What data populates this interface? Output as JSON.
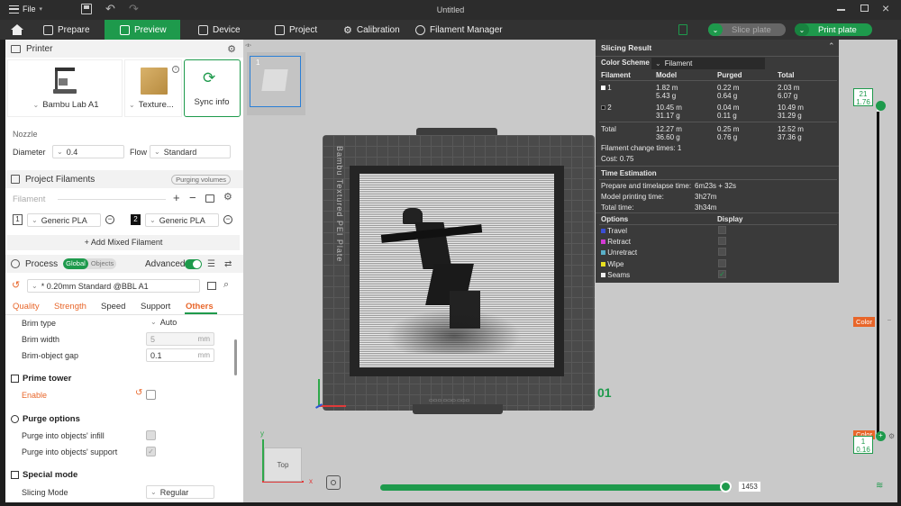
{
  "titlebar": {
    "file_label": "File",
    "title": "Untitled"
  },
  "nav": {
    "tabs": [
      {
        "label": "Prepare"
      },
      {
        "label": "Preview"
      },
      {
        "label": "Device"
      },
      {
        "label": "Project"
      },
      {
        "label": "Calibration"
      },
      {
        "label": "Filament Manager"
      }
    ],
    "slice_plate": "Slice plate",
    "print_plate": "Print plate"
  },
  "printer": {
    "section_title": "Printer",
    "printer_name": "Bambu Lab A1",
    "plate_name": "Texture...",
    "sync_info": "Sync info",
    "nozzle_label": "Nozzle",
    "diameter_label": "Diameter",
    "diameter_value": "0.4",
    "flow_label": "Flow",
    "flow_value": "Standard"
  },
  "filaments": {
    "section_title": "Project Filaments",
    "purging_volumes": "Purging volumes",
    "filament_label": "Filament",
    "items": [
      {
        "index": "1",
        "name": "Generic PLA",
        "color": "#ffffff"
      },
      {
        "index": "2",
        "name": "Generic PLA",
        "color": "#111111"
      }
    ],
    "add_mixed": "+ Add Mixed Filament"
  },
  "process": {
    "section_title": "Process",
    "toggle_global": "Global",
    "toggle_objects": "Objects",
    "advanced_label": "Advanced",
    "preset": "* 0.20mm Standard @BBL A1",
    "tabs": [
      "Quality",
      "Strength",
      "Speed",
      "Support",
      "Others"
    ],
    "active_tab": "Others",
    "brim_type_label": "Brim type",
    "brim_type_value": "Auto",
    "brim_width_label": "Brim width",
    "brim_width_value": "5",
    "brim_gap_label": "Brim-object gap",
    "brim_gap_value": "0.1",
    "unit_mm": "mm",
    "prime_tower_title": "Prime tower",
    "enable_label": "Enable",
    "purge_title": "Purge options",
    "purge_infill_label": "Purge into objects' infill",
    "purge_support_label": "Purge into objects' support",
    "special_mode_title": "Special mode",
    "slicing_mode_label": "Slicing Mode",
    "slicing_mode_value": "Regular"
  },
  "plate": {
    "number": "01",
    "thumb_number": "1",
    "bed_label": "Bambu Textured PEI Plate",
    "view_cube_label": "Top",
    "axis_x": "x",
    "axis_y": "y"
  },
  "slicing_result": {
    "title": "Slicing Result",
    "color_scheme_label": "Color Scheme",
    "color_scheme_value": "Filament",
    "headers": [
      "Filament",
      "Model",
      "Purged",
      "Total"
    ],
    "rows": [
      {
        "filament": "1",
        "color": "#ffffff",
        "model_len": "1.82 m",
        "model_wt": "5.43 g",
        "purged_len": "0.22 m",
        "purged_wt": "0.64 g",
        "total_len": "2.03 m",
        "total_wt": "6.07 g"
      },
      {
        "filament": "2",
        "color": "#111111",
        "model_len": "10.45 m",
        "model_wt": "31.17 g",
        "purged_len": "0.04 m",
        "purged_wt": "0.11 g",
        "total_len": "10.49 m",
        "total_wt": "31.29 g"
      }
    ],
    "total_row": {
      "label": "Total",
      "model_len": "12.27 m",
      "model_wt": "36.60 g",
      "purged_len": "0.25 m",
      "purged_wt": "0.76 g",
      "total_len": "12.52 m",
      "total_wt": "37.36 g"
    },
    "change_times": "Filament change times:  1",
    "cost": "Cost:  0.75",
    "time_title": "Time Estimation",
    "time_rows": [
      {
        "label": "Prepare and timelapse time:",
        "value": "6m23s + 32s"
      },
      {
        "label": "Model printing time:",
        "value": "3h27m"
      },
      {
        "label": "Total time:",
        "value": "3h34m"
      }
    ],
    "options_label": "Options",
    "display_label": "Display",
    "options": [
      {
        "name": "Travel",
        "color": "#3b4fd4",
        "checked": false
      },
      {
        "name": "Retract",
        "color": "#d43bd4",
        "checked": false
      },
      {
        "name": "Unretract",
        "color": "#5ab0c8",
        "checked": false
      },
      {
        "name": "Wipe",
        "color": "#e8e020",
        "checked": false
      },
      {
        "name": "Seams",
        "color": "#f0f0f0",
        "checked": true
      }
    ]
  },
  "layer_slider": {
    "top_layer": "21",
    "top_height": "1.76",
    "bottom_layer": "1",
    "bottom_height": "0.16",
    "color_label": "Color",
    "color_label2": "Color"
  },
  "move_slider": {
    "value": "1453",
    "fraction": 1.0
  }
}
